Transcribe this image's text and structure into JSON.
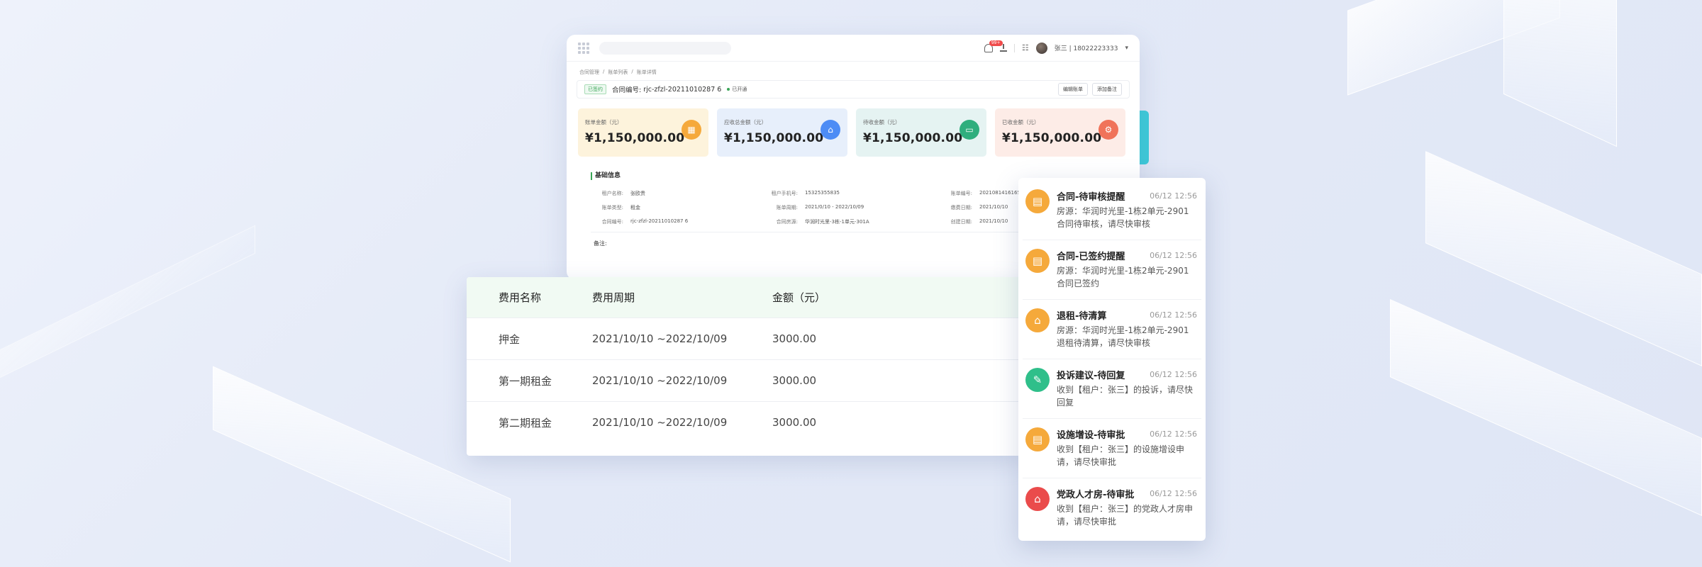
{
  "topbar": {
    "badge": "99+",
    "user": "张三 | 18022223333",
    "chevron": "▾"
  },
  "breadcrumb": [
    "合同管理",
    "/",
    "账单列表",
    "/",
    "账单详情"
  ],
  "contract": {
    "tag": "已签约",
    "number_label": "合同编号:",
    "number": "rjc-zfzl-20211010287 6",
    "status": "已开通",
    "btn_edit": "编辑账单",
    "btn_note": "添加备注"
  },
  "cards": [
    {
      "label": "账单金额（元）",
      "value": "¥1,150,000.00",
      "bg": "#fdf3dc",
      "icon_bg": "#f5a93b",
      "icon": "calendar-icon"
    },
    {
      "label": "应收总金额（元）",
      "value": "¥1,150,000.00",
      "bg": "#e7effb",
      "icon_bg": "#4d8cf5",
      "icon": "home-icon"
    },
    {
      "label": "待收金额（元）",
      "value": "¥1,150,000.00",
      "bg": "#e5f3f2",
      "icon_bg": "#2fae7d",
      "icon": "car-icon"
    },
    {
      "label": "已收金额（元）",
      "value": "¥1,150,000.00",
      "bg": "#fdece7",
      "icon_bg": "#f0735a",
      "icon": "settings-icon"
    }
  ],
  "basic_info": {
    "title": "基础信息",
    "rows": [
      [
        {
          "k": "租户名称:",
          "v": "张欧贵"
        },
        {
          "k": "租户手机号:",
          "v": "15325355835"
        },
        {
          "k": "账单编号:",
          "v": "20210814161653"
        }
      ],
      [
        {
          "k": "账单类型:",
          "v": "租金"
        },
        {
          "k": "账单周期:",
          "v": "2021/0/10 - 2022/10/09"
        },
        {
          "k": "缴费日期:",
          "v": "2021/10/10"
        }
      ],
      [
        {
          "k": "合同编号:",
          "v": "rjc-zfzl-20211010287 6"
        },
        {
          "k": "合同房源:",
          "v": "华润时光里-3栋-1单元-301A"
        },
        {
          "k": "创建日期:",
          "v": "2021/10/10"
        }
      ]
    ],
    "remark_label": "备注:"
  },
  "table": {
    "headers": [
      "费用名称",
      "费用周期",
      "金额（元）"
    ],
    "rows": [
      [
        "押金",
        "2021/10/10 ~2022/10/09",
        "3000.00"
      ],
      [
        "第一期租金",
        "2021/10/10 ~2022/10/09",
        "3000.00"
      ],
      [
        "第二期租金",
        "2021/10/10 ~2022/10/09",
        "3000.00"
      ]
    ]
  },
  "notifications": [
    {
      "title": "合同-待审核提醒",
      "time": "06/12 12:56",
      "text": "房源：华润时光里-1栋2单元-2901 合同待审核，请尽快审核",
      "color": "#f5a93b",
      "icon": "document-icon"
    },
    {
      "title": "合同-已签约提醒",
      "time": "06/12 12:56",
      "text": "房源：华润时光里-1栋2单元-2901 合同已签约",
      "color": "#f5a93b",
      "icon": "document-icon"
    },
    {
      "title": "退租-待清算",
      "time": "06/12 12:56",
      "text": "房源：华润时光里-1栋2单元-2901 退租待清算，请尽快审核",
      "color": "#f5a93b",
      "icon": "house-icon"
    },
    {
      "title": "投诉建议-待回复",
      "time": "06/12 12:56",
      "text": "收到【租户：张三】的投诉，请尽快回复",
      "color": "#2fbf8a",
      "icon": "message-icon"
    },
    {
      "title": "设施增设-待审批",
      "time": "06/12 12:56",
      "text": "收到【租户：张三】的设施增设申请，请尽快审批",
      "color": "#f5a93b",
      "icon": "clipboard-icon"
    },
    {
      "title": "党政人才房-待审批",
      "time": "06/12 12:56",
      "text": "收到【租户：张三】的党政人才房申请，请尽快审批",
      "color": "#ea4b4b",
      "icon": "home-badge-icon"
    }
  ]
}
